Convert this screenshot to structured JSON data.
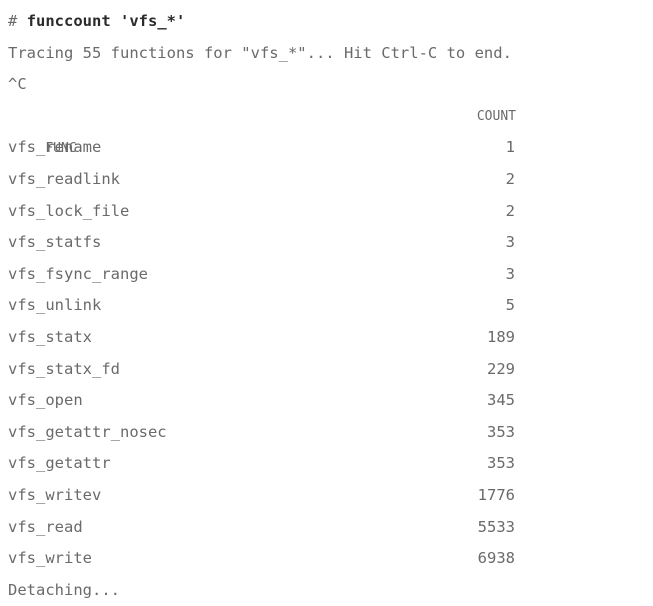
{
  "command": {
    "prompt": "#",
    "text": "funccount 'vfs_*'"
  },
  "tracing_message": "Tracing 55 functions for \"vfs_*\"... Hit Ctrl-C to end.",
  "interrupt": "^C",
  "table": {
    "columns": [
      "FUNC",
      "COUNT"
    ],
    "rows": [
      {
        "func": "vfs_rename",
        "count": "1"
      },
      {
        "func": "vfs_readlink",
        "count": "2"
      },
      {
        "func": "vfs_lock_file",
        "count": "2"
      },
      {
        "func": "vfs_statfs",
        "count": "3"
      },
      {
        "func": "vfs_fsync_range",
        "count": "3"
      },
      {
        "func": "vfs_unlink",
        "count": "5"
      },
      {
        "func": "vfs_statx",
        "count": "189"
      },
      {
        "func": "vfs_statx_fd",
        "count": "229"
      },
      {
        "func": "vfs_open",
        "count": "345"
      },
      {
        "func": "vfs_getattr_nosec",
        "count": "353"
      },
      {
        "func": "vfs_getattr",
        "count": "353"
      },
      {
        "func": "vfs_writev",
        "count": "1776"
      },
      {
        "func": "vfs_read",
        "count": "5533"
      },
      {
        "func": "vfs_write",
        "count": "6938"
      }
    ]
  },
  "footer": "Detaching..."
}
